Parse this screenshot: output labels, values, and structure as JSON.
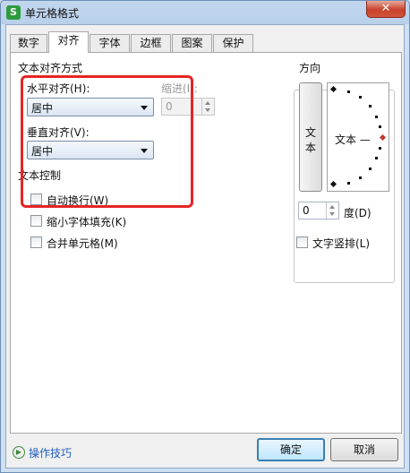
{
  "window": {
    "title": "单元格格式",
    "app_icon": "S",
    "close_glyph": "✕"
  },
  "tabs": [
    {
      "label": "数字",
      "active": false
    },
    {
      "label": "对齐",
      "active": true
    },
    {
      "label": "字体",
      "active": false
    },
    {
      "label": "边框",
      "active": false
    },
    {
      "label": "图案",
      "active": false
    },
    {
      "label": "保护",
      "active": false
    }
  ],
  "alignment": {
    "group_title": "文本对齐方式",
    "horizontal_label": "水平对齐(H):",
    "horizontal_value": "居中",
    "indent_label": "缩进(I):",
    "indent_value": "0",
    "vertical_label": "垂直对齐(V):",
    "vertical_value": "居中"
  },
  "text_control": {
    "group_title": "文本控制",
    "wrap_label": "自动换行(W)",
    "shrink_label": "缩小字体填充(K)",
    "merge_label": "合并单元格(M)"
  },
  "orientation": {
    "group_title": "方向",
    "vertical_text_button": "文本",
    "dial_label": "文本 —",
    "degrees_value": "0",
    "degrees_label": "度(D)",
    "vertical_checkbox_label": "文字竖排(L)"
  },
  "footer": {
    "help_link": "操作技巧",
    "ok_label": "确定",
    "cancel_label": "取消"
  },
  "colors": {
    "highlight_box": "#e52525",
    "dial_marker": "#c0392b"
  }
}
